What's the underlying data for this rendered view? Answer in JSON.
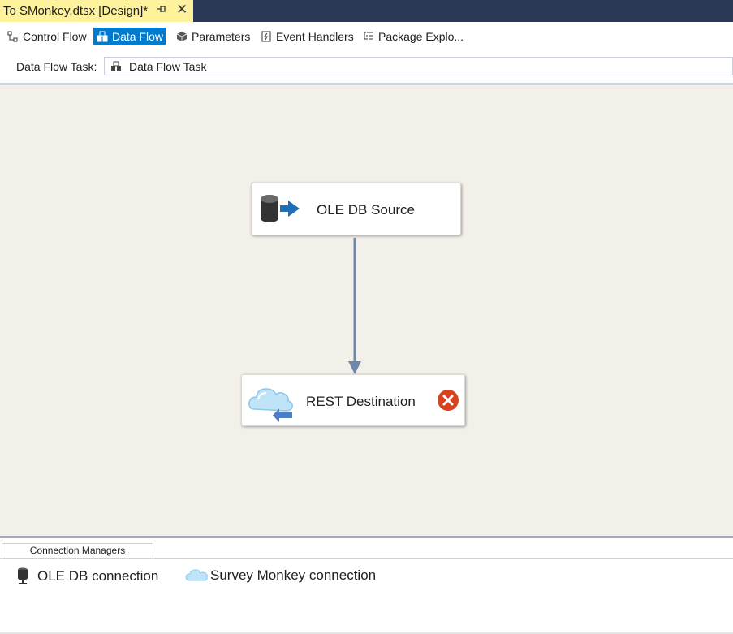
{
  "document_tab": {
    "title": "To SMonkey.dtsx [Design]*",
    "pin_icon": "pin-icon",
    "close_icon": "close-icon"
  },
  "designer_tabs": [
    {
      "label": "Control Flow",
      "icon": "control-flow-icon",
      "active": false
    },
    {
      "label": "Data Flow",
      "icon": "data-flow-icon",
      "active": true
    },
    {
      "label": "Parameters",
      "icon": "parameters-icon",
      "active": false
    },
    {
      "label": "Event Handlers",
      "icon": "event-handlers-icon",
      "active": false
    },
    {
      "label": "Package Explo...",
      "icon": "package-explorer-icon",
      "active": false
    }
  ],
  "data_flow_task": {
    "label": "Data Flow Task:",
    "selected": "Data Flow Task"
  },
  "components": [
    {
      "name": "OLE DB Source",
      "icon": "ole-db-source-icon",
      "status": "ok"
    },
    {
      "name": "REST Destination",
      "icon": "rest-destination-icon",
      "status": "error",
      "status_icon": "error-icon"
    }
  ],
  "connection_managers": {
    "tab_label": "Connection Managers",
    "items": [
      {
        "label": "OLE DB connection",
        "icon": "database-connection-icon"
      },
      {
        "label": "Survey Monkey connection",
        "icon": "cloud-connection-icon"
      }
    ]
  },
  "colors": {
    "title_bar": "#293955",
    "active_doc_tab": "#fff29d",
    "active_designer_tab": "#007acc",
    "canvas": "#f3f0e9",
    "path_arrow": "#6d87ad",
    "error": "#d74321"
  }
}
